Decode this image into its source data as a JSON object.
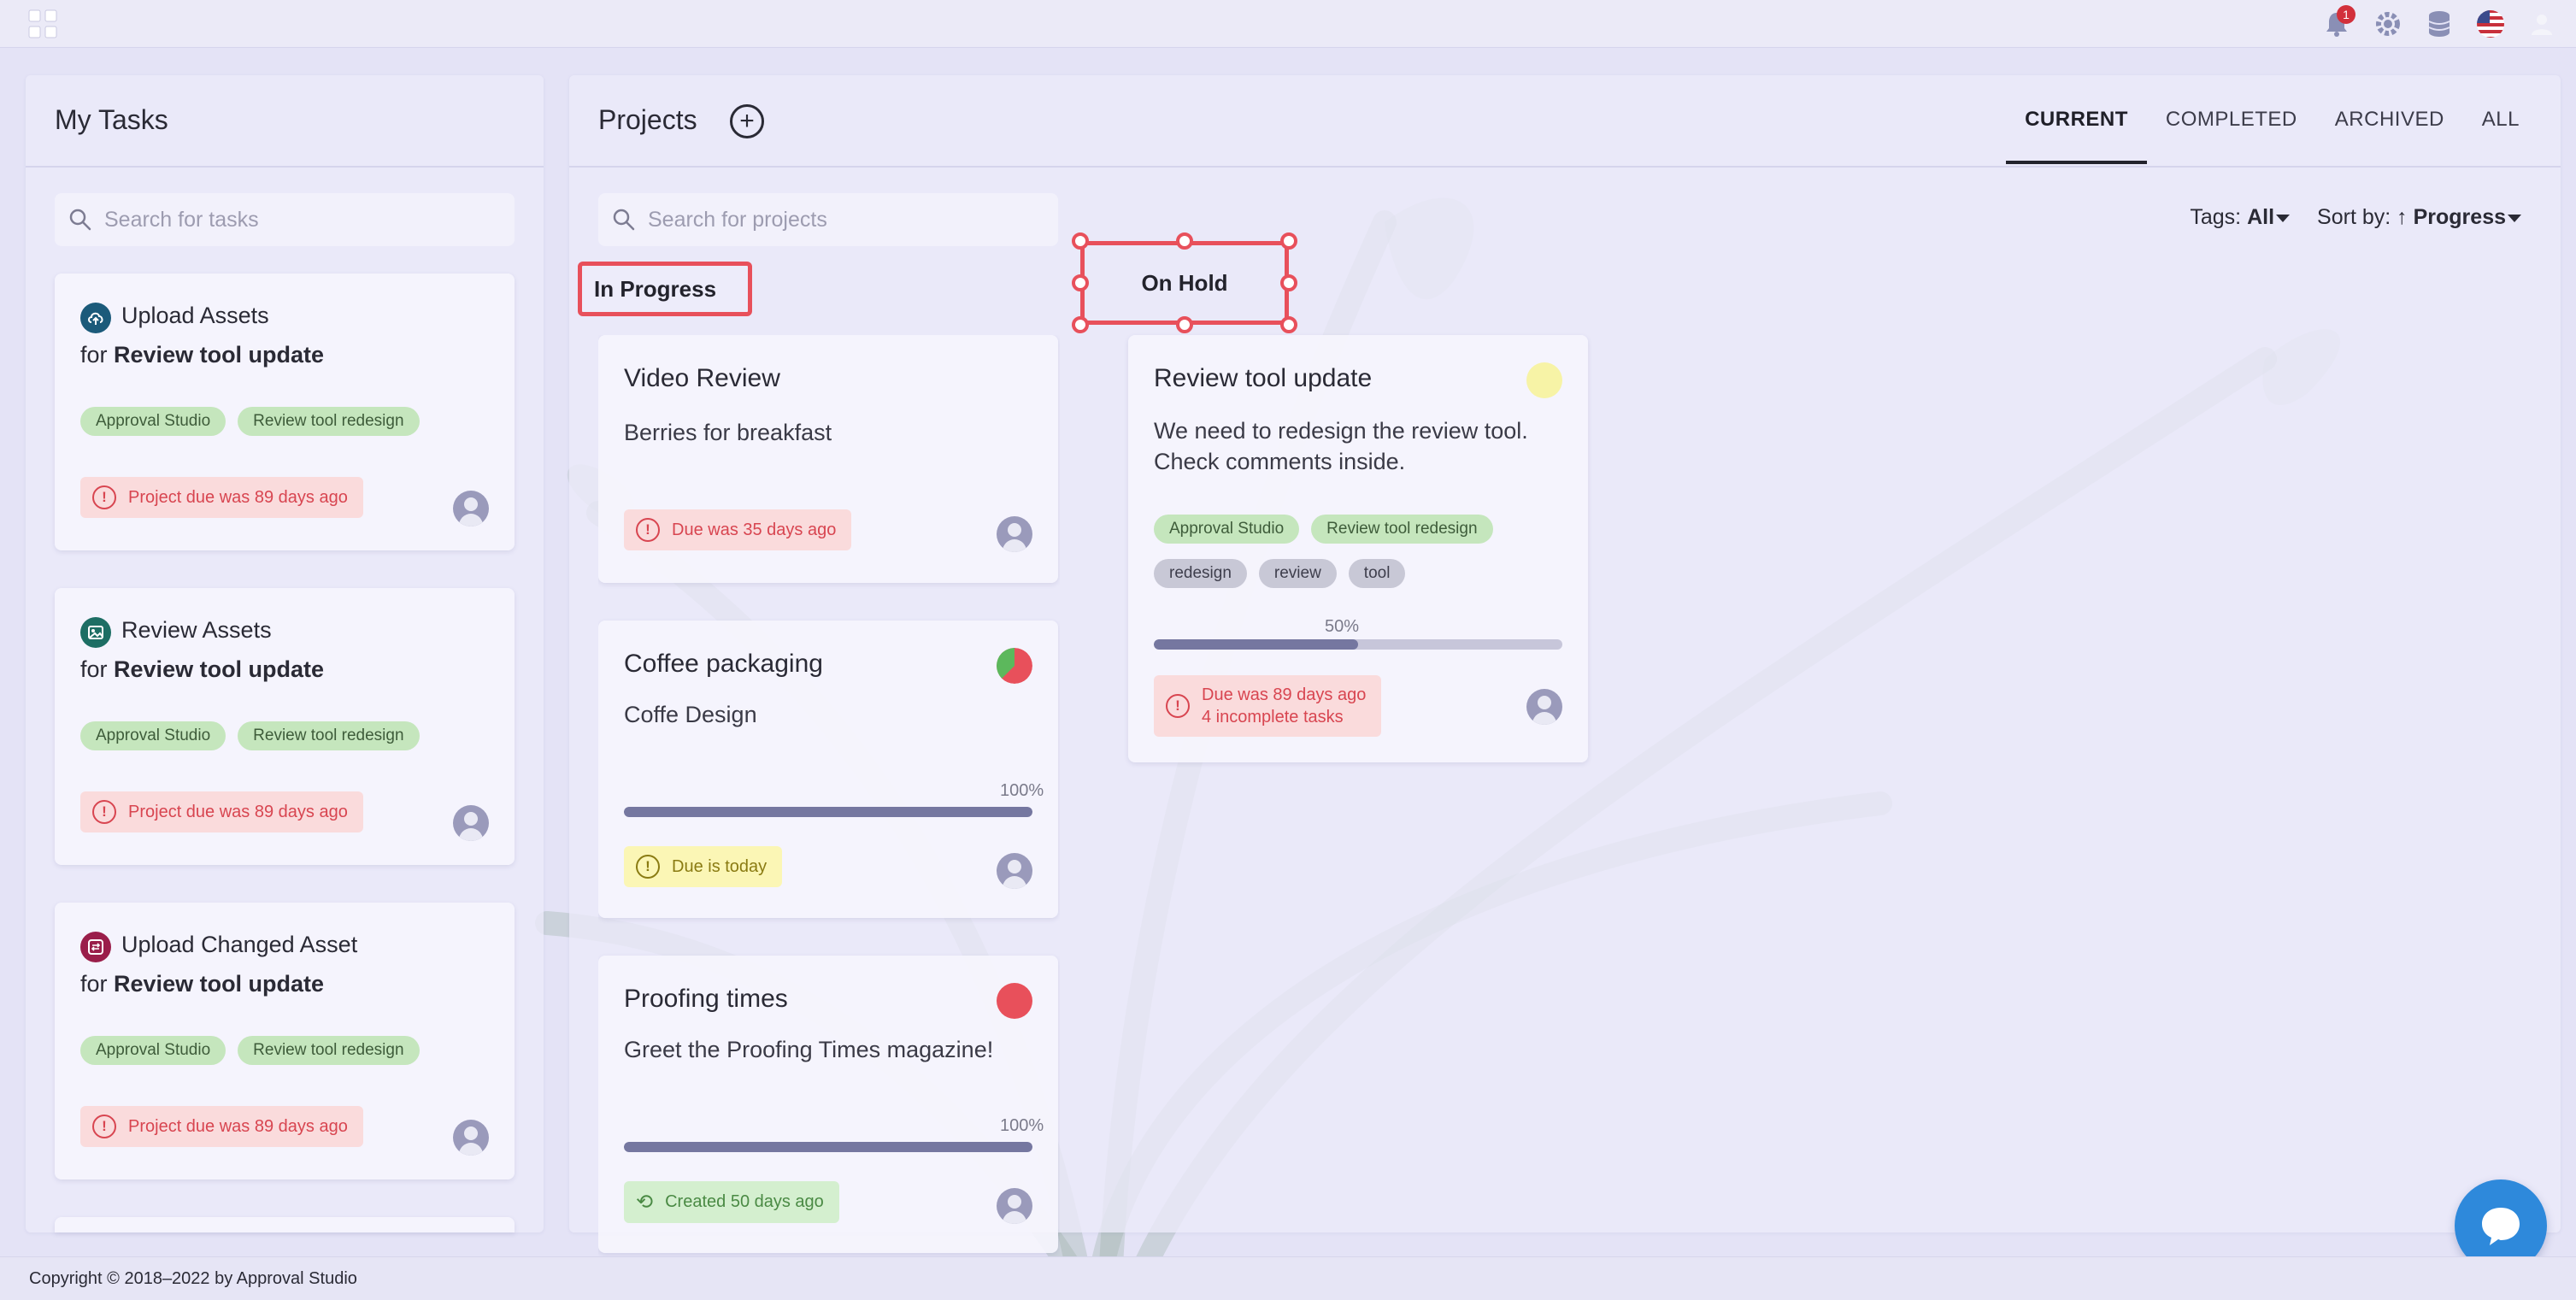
{
  "header": {
    "notification_count": "1",
    "icons": [
      "logo-grid-icon",
      "bell-icon",
      "gear-icon",
      "database-icon",
      "us-flag-icon",
      "user-icon"
    ]
  },
  "tasks_panel": {
    "title": "My Tasks",
    "search_placeholder": "Search for tasks",
    "items": [
      {
        "icon": "upload-cloud-icon",
        "icon_color": "#1b5a7a",
        "title": "Upload Assets",
        "for_prefix": "for",
        "project": "Review tool update",
        "tags": [
          "Approval Studio",
          "Review tool redesign"
        ],
        "due": "Project due was 89 days ago"
      },
      {
        "icon": "image-icon",
        "icon_color": "#1d6e64",
        "title": "Review Assets",
        "for_prefix": "for",
        "project": "Review tool update",
        "tags": [
          "Approval Studio",
          "Review tool redesign"
        ],
        "due": "Project due was 89 days ago"
      },
      {
        "icon": "swap-icon",
        "icon_color": "#9a1e4a",
        "title": "Upload Changed Asset",
        "for_prefix": "for",
        "project": "Review tool update",
        "tags": [
          "Approval Studio",
          "Review tool redesign"
        ],
        "due": "Project due was 89 days ago"
      }
    ]
  },
  "projects_panel": {
    "title": "Projects",
    "search_placeholder": "Search for projects",
    "tabs": [
      "CURRENT",
      "COMPLETED",
      "ARCHIVED",
      "ALL"
    ],
    "active_tab": "CURRENT",
    "tags_filter": {
      "label": "Tags:",
      "value": "All"
    },
    "sort": {
      "label": "Sort by:",
      "arrow": "↑",
      "value": "Progress"
    },
    "columns": {
      "in_progress": {
        "label": "In Progress",
        "cards": [
          {
            "title": "Video Review",
            "description": "Berries for breakfast",
            "due": "Due was 35 days ago",
            "due_style": "red"
          },
          {
            "title": "Coffee packaging",
            "description": "Coffe Design",
            "progress_label": "100%",
            "progress": 1.0,
            "due": "Due is today",
            "due_style": "yellow",
            "status": "pie-green-red"
          },
          {
            "title": "Proofing times",
            "description": "Greet the Proofing Times magazine!",
            "progress_label": "100%",
            "progress": 1.0,
            "due": "Created 50 days ago",
            "due_style": "green",
            "status": "red"
          }
        ]
      },
      "on_hold": {
        "label": "On Hold",
        "cards": [
          {
            "title": "Review tool update",
            "description_line1": "We need to redesign the review tool.",
            "description_line2": "Check comments inside.",
            "tags_green": [
              "Approval Studio",
              "Review tool redesign"
            ],
            "tags_grey": [
              "redesign",
              "review",
              "tool"
            ],
            "progress_label": "50%",
            "progress": 0.5,
            "due_line1": "Due was 89 days ago",
            "due_line2": "4 incomplete tasks",
            "status": "yellow"
          }
        ]
      }
    }
  },
  "footer": {
    "copyright": "Copyright © 2018–2022 by Approval Studio"
  },
  "colors": {
    "accent_red": "#e8505b",
    "chat": "#2e89db",
    "progress": "#7577a0"
  }
}
